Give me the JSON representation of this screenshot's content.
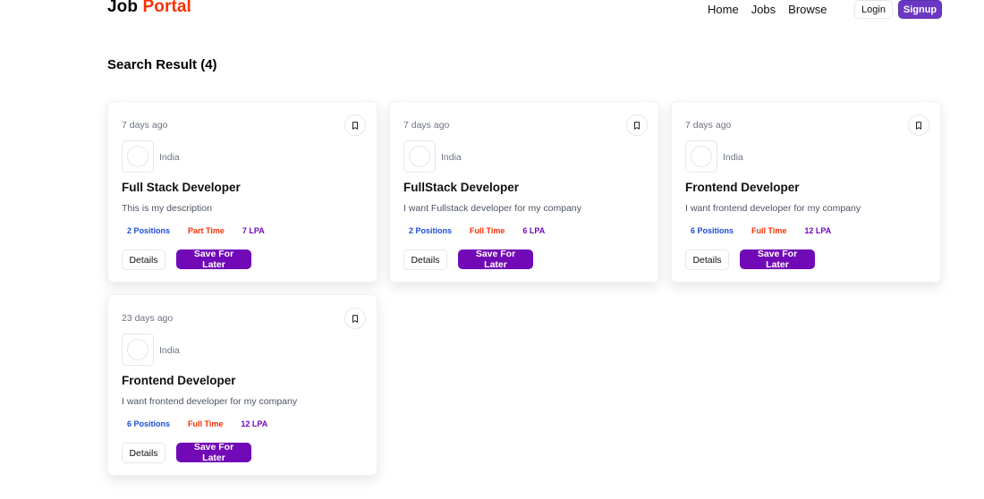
{
  "navbar": {
    "logo_main": "Job ",
    "logo_accent": "Portal",
    "links": [
      "Home",
      "Jobs",
      "Browse"
    ],
    "login_label": "Login",
    "signup_label": "Signup",
    "accent_color": "#F83002",
    "signup_color": "#6A38C2"
  },
  "results": {
    "title": "Search Result (4)"
  },
  "jobs": [
    {
      "posted": "7 days ago",
      "location": "India",
      "title": "Full Stack Developer",
      "description": "This is my description",
      "positions": "2 Positions",
      "job_type": "Part Time",
      "salary": "7 LPA",
      "details_label": "Details",
      "save_label": "Save For Later",
      "bookmark_icon": "bookmark-icon"
    },
    {
      "posted": "7 days ago",
      "location": "India",
      "title": "FullStack Developer",
      "description": "I want Fullstack developer for my company",
      "positions": "2 Positions",
      "job_type": "Full Time",
      "salary": "6 LPA",
      "details_label": "Details",
      "save_label": "Save For Later",
      "bookmark_icon": "bookmark-icon"
    },
    {
      "posted": "7 days ago",
      "location": "India",
      "title": "Frontend Developer",
      "description": "I want frontend developer for my company",
      "positions": "6 Positions",
      "job_type": "Full Time",
      "salary": "12 LPA",
      "details_label": "Details",
      "save_label": "Save For Later",
      "bookmark_icon": "bookmark-icon"
    },
    {
      "posted": "23 days ago",
      "location": "India",
      "title": "Frontend Developer",
      "description": "I want frontend developer for my company",
      "positions": "6 Positions",
      "job_type": "Full Time",
      "salary": "12 LPA",
      "details_label": "Details",
      "save_label": "Save For Later",
      "bookmark_icon": "bookmark-icon"
    }
  ],
  "colors": {
    "positions": "#1d4ed8",
    "job_type": "#F83002",
    "salary": "#7209b7",
    "save_button": "#7209b7"
  }
}
